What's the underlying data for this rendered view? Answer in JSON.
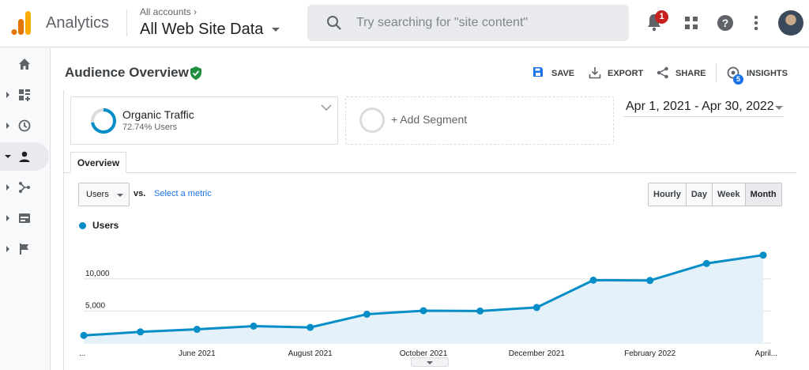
{
  "app": {
    "name": "Analytics"
  },
  "account": {
    "picker_small": "All accounts",
    "property": "All Web Site Data"
  },
  "search": {
    "placeholder": "Try searching for \"site content\""
  },
  "notifications": {
    "count": "1"
  },
  "report": {
    "title": "Audience Overview",
    "actions": {
      "save": "SAVE",
      "export": "EXPORT",
      "share": "SHARE",
      "insights": "INSIGHTS",
      "insights_count": "5"
    }
  },
  "segments": {
    "active": {
      "name": "Organic Traffic",
      "share": "72.74% Users",
      "share_value": 72.74
    },
    "add_label": "+ Add Segment"
  },
  "date_range": "Apr 1, 2021 - Apr 30, 2022",
  "tabs": {
    "overview": "Overview"
  },
  "controls": {
    "metric": "Users",
    "vs": "vs.",
    "select_metric": "Select a metric",
    "periods": [
      "Hourly",
      "Day",
      "Week",
      "Month"
    ],
    "period_selected": "Month"
  },
  "sidebar": {
    "items": [
      {
        "icon": "home-icon"
      },
      {
        "icon": "customization-icon"
      },
      {
        "icon": "realtime-icon"
      },
      {
        "icon": "audience-icon",
        "active": true
      },
      {
        "icon": "acquisition-icon"
      },
      {
        "icon": "behavior-icon"
      },
      {
        "icon": "conversions-icon"
      }
    ]
  },
  "colors": {
    "series": "#058dc7",
    "accent": "#1a73e8",
    "badge": "#c5221f",
    "verified": "#1e8e3e"
  },
  "chart_data": {
    "type": "area",
    "series": [
      {
        "name": "Users",
        "x": [
          "2021-04",
          "2021-05",
          "2021-06",
          "2021-07",
          "2021-08",
          "2021-09",
          "2021-10",
          "2021-11",
          "2021-12",
          "2022-01",
          "2022-02",
          "2022-03",
          "2022-04"
        ],
        "values": [
          1200,
          1750,
          2150,
          2650,
          2450,
          4500,
          5050,
          5000,
          5550,
          9800,
          9750,
          12400,
          13700
        ]
      }
    ],
    "x_tick_labels": [
      "...",
      "June 2021",
      "August 2021",
      "October 2021",
      "December 2021",
      "February 2022",
      "April..."
    ],
    "y_tick_labels": [
      "5,000",
      "10,000"
    ],
    "ylim": [
      0,
      16000
    ],
    "grid": true
  }
}
